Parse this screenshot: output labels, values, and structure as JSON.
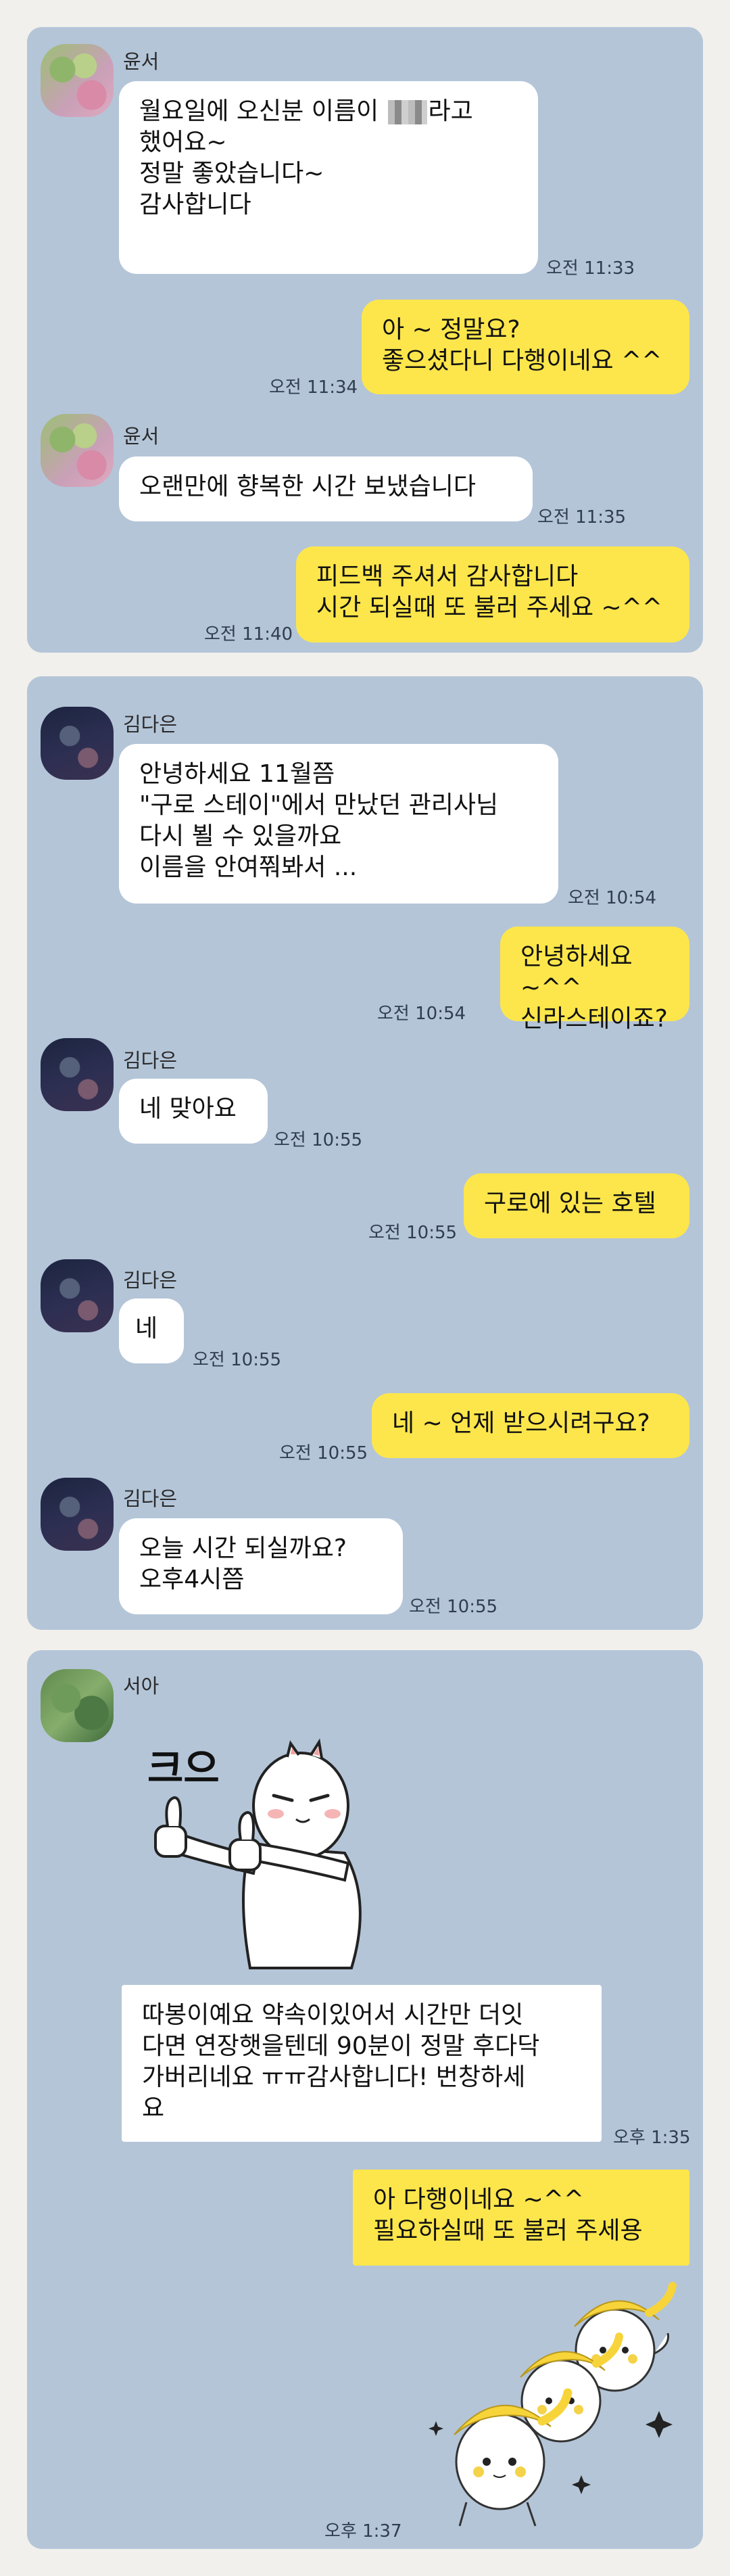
{
  "chat1": {
    "sender1": "윤서",
    "msg1_before": "월요일에 오신분 이름이 ",
    "msg1_after": "라고\n했어요~\n정말 좋았습니다~\n감사합니다",
    "time1": "오전 11:33",
    "reply1": "아 ~ 정말요?\n좋으셨다니 다행이네요 ^^",
    "time2": "오전 11:34",
    "sender2": "윤서",
    "msg2": "오랜만에 향복한 시간 보냈습니다",
    "time3": "오전 11:35",
    "reply2": "피드백 주셔서 감사합니다\n시간 되실때 또 불러 주세요 ~^^",
    "time4": "오전 11:40"
  },
  "chat2": {
    "sender": "김다은",
    "msg1": "안녕하세요 11월쯤\n\"구로 스테이\"에서 만났던 관리사님\n다시 뵐 수 있을까요\n이름을 안여쭤봐서 ...",
    "time1": "오전 10:54",
    "reply1": "안녕하세요 ~^^\n신라스테이죠?",
    "time2": "오전 10:54",
    "msg2": "네 맞아요",
    "time3": "오전 10:55",
    "reply2": "구로에 있는 호텔",
    "time4": "오전 10:55",
    "msg3": "네",
    "time5": "오전 10:55",
    "reply3": "네 ~ 언제 받으시려구요?",
    "time6": "오전 10:55",
    "msg4": "오늘  시간 되실까요?\n오후4시쯤",
    "time7": "오전 10:55"
  },
  "chat3": {
    "sender": "서아",
    "sticker_text": "크으",
    "msg1": "따봉이예요 약속이있어서 시간만 더잇\n다면 연장햇을텐데 90분이 정말 후다닥\n가버리네요 ㅠㅠ감사합니다! 번창하세\n요",
    "time1": "오후 1:35",
    "reply1": "아 다행이네요 ~^^\n필요하실때 또 불러 주세용",
    "time2": "오후 1:37"
  },
  "colors": {
    "chat_bg": "#b4c5d8",
    "my_bubble": "#fde64b",
    "other_bubble": "#ffffff"
  },
  "icons": [
    "thumbs-up-cat-sticker",
    "banana-hat-characters-sticker"
  ]
}
